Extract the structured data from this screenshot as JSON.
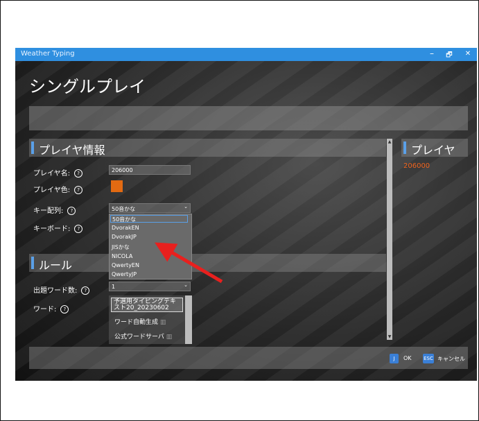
{
  "window": {
    "title": "Weather Typing",
    "minimize": "–",
    "restore": "🗗",
    "close": "✕"
  },
  "page": {
    "heading": "シングルプレイ"
  },
  "player_info": {
    "section_title": "プレイヤ情報",
    "name_label": "プレイヤ名:",
    "name_value": "206000",
    "color_label": "プレイヤ色:",
    "color_value": "#e26a12",
    "layout_label": "キー配列:",
    "layout_value": "50音かな",
    "keyboard_label": "キーボード:",
    "layout_options": [
      "50音かな",
      "DvorakEN",
      "DvorakJP",
      "JISかな",
      "NICOLA",
      "QwertyEN",
      "QwertyJP"
    ]
  },
  "rules": {
    "section_title": "ルール",
    "count_label": "出題ワード数:",
    "count_value": "1",
    "word_label": "ワード:",
    "word_items": [
      "予選用タイピングテキスト20_20230602",
      "ワード自動生成",
      "公式ワードサーバ"
    ]
  },
  "player_panel": {
    "title": "プレイヤ",
    "name": "206000",
    "name_color": "#f0641e"
  },
  "footer": {
    "ok_key": "J",
    "ok_label": "OK",
    "cancel_key": "ESC",
    "cancel_label": "キャンセル"
  },
  "help_glyph": "?",
  "colors": {
    "accent": "#2f8fe0",
    "annotation_arrow": "#e8201e"
  }
}
